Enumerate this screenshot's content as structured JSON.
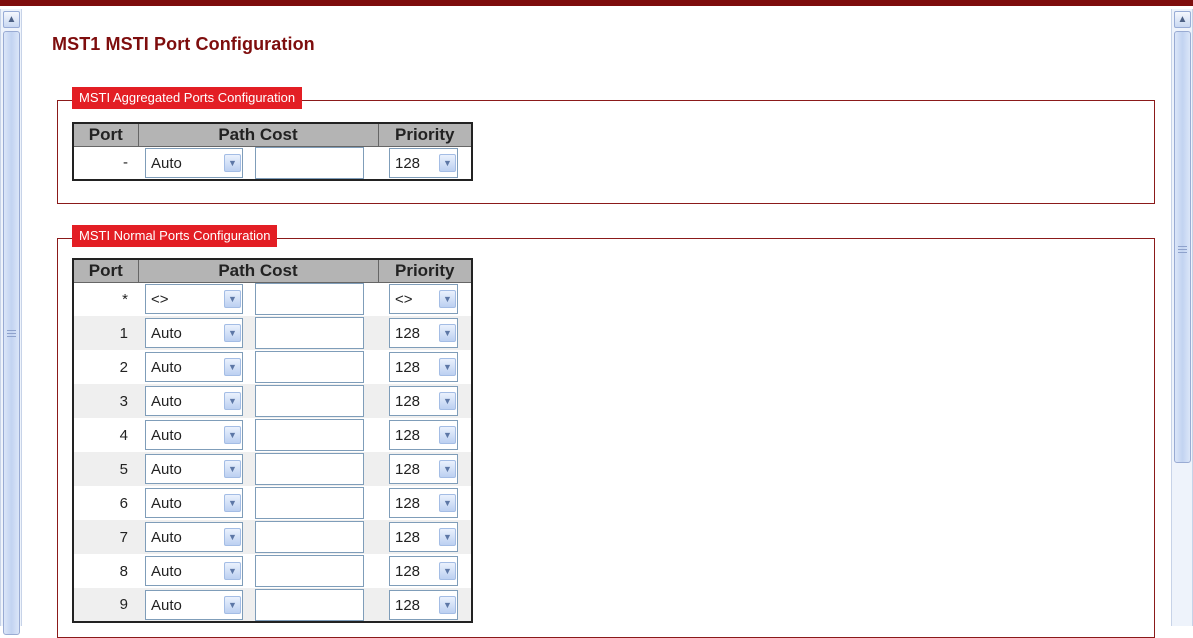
{
  "page": {
    "title": "MST1 MSTI Port Configuration"
  },
  "icons": {
    "scroll_up": "▲",
    "dropdown": "▼"
  },
  "aggregated": {
    "legend": "MSTI Aggregated Ports Configuration",
    "headers": {
      "port": "Port",
      "path_cost": "Path Cost",
      "priority": "Priority"
    },
    "row": {
      "port": "-",
      "path_cost": "Auto",
      "cost_value": "",
      "priority": "128"
    }
  },
  "normal": {
    "legend": "MSTI Normal Ports Configuration",
    "headers": {
      "port": "Port",
      "path_cost": "Path Cost",
      "priority": "Priority"
    },
    "rows": [
      {
        "port": "*",
        "path_cost": "<>",
        "cost_value": "",
        "priority": "<>"
      },
      {
        "port": "1",
        "path_cost": "Auto",
        "cost_value": "",
        "priority": "128"
      },
      {
        "port": "2",
        "path_cost": "Auto",
        "cost_value": "",
        "priority": "128"
      },
      {
        "port": "3",
        "path_cost": "Auto",
        "cost_value": "",
        "priority": "128"
      },
      {
        "port": "4",
        "path_cost": "Auto",
        "cost_value": "",
        "priority": "128"
      },
      {
        "port": "5",
        "path_cost": "Auto",
        "cost_value": "",
        "priority": "128"
      },
      {
        "port": "6",
        "path_cost": "Auto",
        "cost_value": "",
        "priority": "128"
      },
      {
        "port": "7",
        "path_cost": "Auto",
        "cost_value": "",
        "priority": "128"
      },
      {
        "port": "8",
        "path_cost": "Auto",
        "cost_value": "",
        "priority": "128"
      },
      {
        "port": "9",
        "path_cost": "Auto",
        "cost_value": "",
        "priority": "128"
      }
    ]
  }
}
